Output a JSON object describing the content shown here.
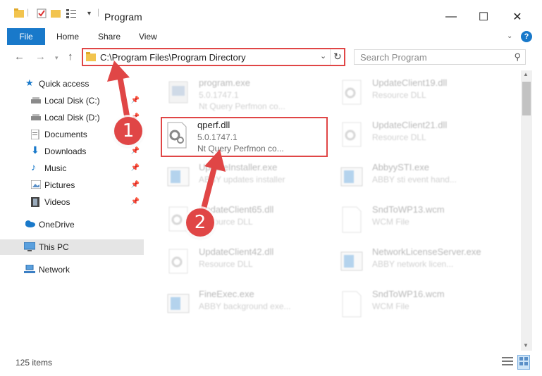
{
  "window": {
    "title": "Program",
    "controls": {
      "minimize": "—",
      "maximize": "☐",
      "close": "✕"
    }
  },
  "ribbon": {
    "tabs": [
      "File",
      "Home",
      "Share",
      "View"
    ],
    "help": "?"
  },
  "address": {
    "path": "C:\\Program Files\\Program Directory",
    "search_placeholder": "Search Program"
  },
  "nav": {
    "items": [
      {
        "label": "Quick access",
        "icon": "star-icon",
        "pinned": false
      },
      {
        "label": "Local Disk (C:)",
        "icon": "drive-icon",
        "pinned": true
      },
      {
        "label": "Local Disk (D:)",
        "icon": "drive-icon",
        "pinned": true
      },
      {
        "label": "Documents",
        "icon": "documents-icon",
        "pinned": true
      },
      {
        "label": "Downloads",
        "icon": "download-icon",
        "pinned": true
      },
      {
        "label": "Music",
        "icon": "music-icon",
        "pinned": true
      },
      {
        "label": "Pictures",
        "icon": "pictures-icon",
        "pinned": true
      },
      {
        "label": "Videos",
        "icon": "videos-icon",
        "pinned": true
      },
      {
        "label": "OneDrive",
        "icon": "cloud-icon",
        "pinned": false
      },
      {
        "label": "This PC",
        "icon": "pc-icon",
        "pinned": false
      },
      {
        "label": "Network",
        "icon": "network-icon",
        "pinned": false
      }
    ]
  },
  "files": [
    {
      "name": "program.exe",
      "line2": "5.0.1747.1",
      "line3": "Nt Query Perfmon co...",
      "type": "exe",
      "highlight": false
    },
    {
      "name": "UpdateClient19.dll",
      "line2": "Resource DLL",
      "line3": "",
      "type": "dll",
      "highlight": false
    },
    {
      "name": "qperf.dll",
      "line2": "5.0.1747.1",
      "line3": "Nt Query Perfmon co...",
      "type": "dll",
      "highlight": true
    },
    {
      "name": "UpdateClient21.dll",
      "line2": "Resource DLL",
      "line3": "",
      "type": "dll",
      "highlight": false
    },
    {
      "name": "UpdateInstaller.exe",
      "line2": "ABBY updates installer",
      "line3": "",
      "type": "app",
      "highlight": false
    },
    {
      "name": "AbbyySTI.exe",
      "line2": "ABBY sti event hand...",
      "line3": "",
      "type": "app",
      "highlight": false
    },
    {
      "name": "UpdateClient65.dll",
      "line2": "Resource DLL",
      "line3": "",
      "type": "dll",
      "highlight": false
    },
    {
      "name": "SndToWP13.wcm",
      "line2": "WCM File",
      "line3": "",
      "type": "file",
      "highlight": false
    },
    {
      "name": "UpdateClient42.dll",
      "line2": "Resource DLL",
      "line3": "",
      "type": "dll",
      "highlight": false
    },
    {
      "name": "NetworkLicenseServer.exe",
      "line2": "ABBY network licen...",
      "line3": "",
      "type": "app",
      "highlight": false
    },
    {
      "name": "FineExec.exe",
      "line2": "ABBY background exe...",
      "line3": "",
      "type": "app",
      "highlight": false
    },
    {
      "name": "SndToWP16.wcm",
      "line2": "WCM File",
      "line3": "",
      "type": "file",
      "highlight": false
    }
  ],
  "status": {
    "count": "125 items"
  },
  "annotations": [
    "1",
    "2"
  ],
  "colors": {
    "accent": "#1979ca",
    "highlight": "#e04646",
    "selected": "#e5e5e5"
  }
}
